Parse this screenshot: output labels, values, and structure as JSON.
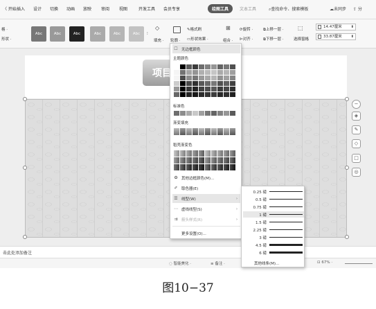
{
  "tabs": [
    "〈 开始",
    "插入",
    "设计",
    "切换",
    "动画",
    "放映",
    "审阅",
    "视图",
    "开发工具",
    "会员专享",
    "绘图工具",
    "文本工具"
  ],
  "active_tab": "绘图工具",
  "search_label": "查找命令、搜索模板",
  "sync_label": "未同步",
  "ribbon": {
    "left_labels": [
      "格 ·",
      "形状 ·"
    ],
    "style_buttons": [
      "Abc",
      "Abc",
      "Abc",
      "Abc",
      "Abc",
      "Abc"
    ],
    "fill_label": "填充 ·",
    "outline_label": "轮廓 ·",
    "format_painter": "格式刷",
    "shape_effect": "形状效果 ·",
    "combine": "组合 ·",
    "rotate": "旋转 ·",
    "align": "对齐 ·",
    "bring_forward": "上移一层 ·",
    "send_backward": "下移一层 ·",
    "select_pane": "选择窗格",
    "height": "14.47厘米",
    "width": "33.87厘米"
  },
  "slide": {
    "title_text": "项目"
  },
  "fill_menu": {
    "no_fill": "无边框颜色",
    "theme_colors": "主题颜色",
    "standard_colors": "标准色",
    "gradient_fill": "渐变填充",
    "picture_gradient": "稻壳渐变色",
    "more_colors": "其他边框颜色(M)...",
    "eyedropper": "取色器(E)",
    "line_width": "线型(W)",
    "dash_type": "虚线线型(S)",
    "arrow_style": "箭头样式(R)",
    "more_settings": "更多设置(O)..."
  },
  "width_menu": {
    "options": [
      "0.25 磅",
      "0.5 磅",
      "0.75 磅",
      "1 磅",
      "1.5 磅",
      "2.25 磅",
      "3 磅",
      "4.5 磅",
      "6 磅"
    ],
    "other": "其他线条(M)..."
  },
  "notes_placeholder": "击此处添加备注",
  "statusbar": {
    "beautify": "智能美化 ·",
    "notes": "备注 ·",
    "zoom": "67% ·"
  },
  "caption": "图10−37"
}
